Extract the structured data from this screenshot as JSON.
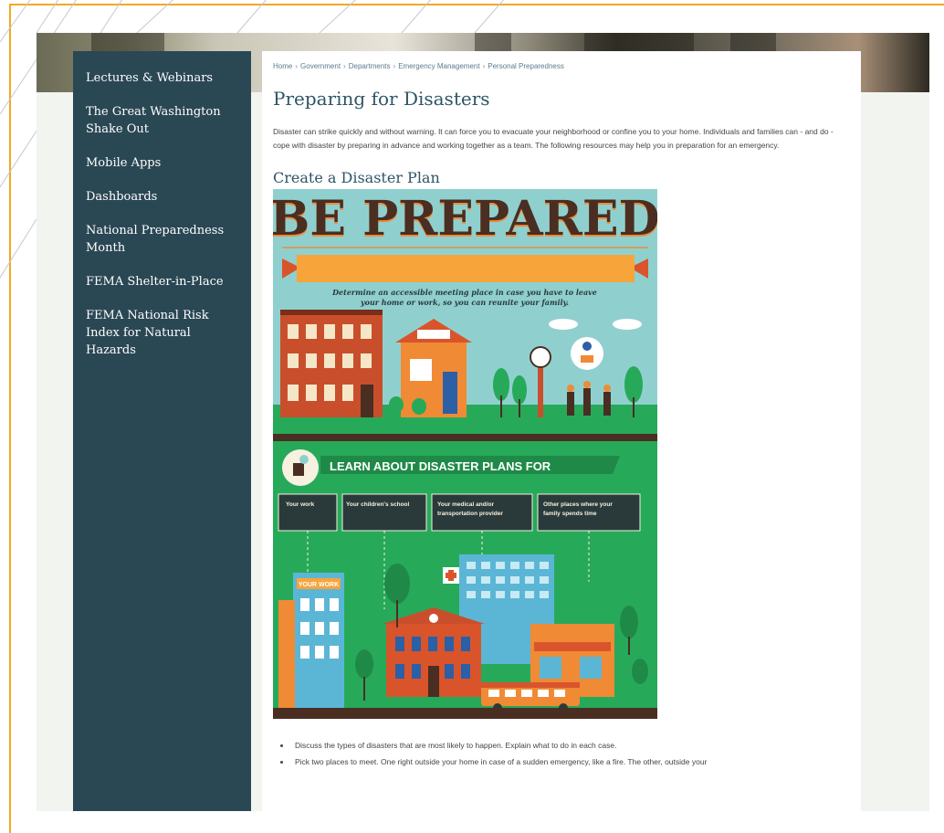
{
  "sidebar": {
    "items": [
      {
        "label": "Lectures & Webinars"
      },
      {
        "label": "The Great Washington Shake Out"
      },
      {
        "label": "Mobile Apps"
      },
      {
        "label": "Dashboards"
      },
      {
        "label": "National Preparedness Month"
      },
      {
        "label": "FEMA Shelter-in-Place"
      },
      {
        "label": "FEMA National Risk Index for Natural Hazards"
      }
    ]
  },
  "breadcrumb": {
    "items": [
      "Home",
      "Government",
      "Departments",
      "Emergency Management",
      "Personal Preparedness"
    ],
    "separator": "›"
  },
  "page": {
    "title": "Preparing for Disasters",
    "intro": "Disaster can strike quickly and without warning.  It can force you to evacuate your neighborhood or confine you to your home.  Individuals and families can - and do - cope with disaster by preparing in advance and working together as a team.  The following resources may help you in preparation for an emergency.",
    "section_title": "Create a Disaster Plan"
  },
  "infographic": {
    "headline": "BE PREPARED",
    "tagline_1": "Determine an accessible meeting place in case you have to leave",
    "tagline_2": "your home or work, so you can reunite your family.",
    "learn_title": "LEARN ABOUT DISASTER PLANS FOR",
    "boxes": [
      [
        "Your work"
      ],
      [
        "Your children's school"
      ],
      [
        "Your medical and/or",
        "transportation provider"
      ],
      [
        "Other places where your",
        "family spends time"
      ]
    ],
    "sign_text": "YOUR WORK",
    "colors": {
      "sky": "#8fd0cf",
      "green": "#27a95a",
      "orange": "#f08a35",
      "brown": "#4a2e22",
      "red": "#d9542b"
    }
  },
  "bullets": [
    "Discuss the types of disasters that are most likely to happen. Explain what to do in each case.",
    "Pick two places to meet. One right outside your home in case of a sudden emergency, like a fire. The other, outside your"
  ]
}
